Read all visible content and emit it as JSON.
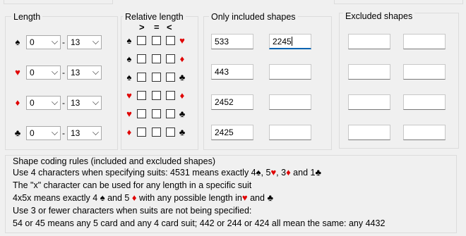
{
  "length": {
    "title": "Length",
    "rows": [
      {
        "suit": "♠",
        "color": "black",
        "min": "0",
        "max": "13"
      },
      {
        "suit": "♥",
        "color": "red",
        "min": "0",
        "max": "13"
      },
      {
        "suit": "♦",
        "color": "red",
        "min": "0",
        "max": "13"
      },
      {
        "suit": "♣",
        "color": "black",
        "min": "0",
        "max": "13"
      }
    ],
    "separator": "-"
  },
  "relative": {
    "title": "Relative length",
    "ops": [
      ">",
      "=",
      "<"
    ],
    "rows": [
      {
        "left": "♠",
        "left_color": "black",
        "right": "♥",
        "right_color": "red"
      },
      {
        "left": "♠",
        "left_color": "black",
        "right": "♦",
        "right_color": "red"
      },
      {
        "left": "♠",
        "left_color": "black",
        "right": "♣",
        "right_color": "black"
      },
      {
        "left": "♥",
        "left_color": "red",
        "right": "♦",
        "right_color": "red"
      },
      {
        "left": "♥",
        "left_color": "red",
        "right": "♣",
        "right_color": "black"
      },
      {
        "left": "♦",
        "left_color": "red",
        "right": "♣",
        "right_color": "black"
      }
    ]
  },
  "included": {
    "title": "Only included shapes",
    "rows": [
      [
        "533",
        "2245"
      ],
      [
        "443",
        ""
      ],
      [
        "2452",
        ""
      ],
      [
        "2425",
        ""
      ]
    ]
  },
  "excluded": {
    "title": "Excluded shapes",
    "rows": [
      [
        "",
        ""
      ],
      [
        "",
        ""
      ],
      [
        "",
        ""
      ],
      [
        "",
        ""
      ]
    ]
  },
  "rules": {
    "title": "Shape coding rules (included and excluded shapes)",
    "line1_a": "Use 4 characters when specifying suits: 4531 means exactly 4",
    "line1_b": ", 5",
    "line1_c": ", 3",
    "line1_d": " and 1",
    "line2": "The \"x\" character can be used for any length in a specific suit",
    "line3_a": "4x5x means exactly 4",
    "line3_b": " and 5",
    "line3_c": " with any possible length in",
    "line3_d": " and",
    "line4": "Use 3 or fewer characters when suits are not being specified:",
    "line5": "54 or 45 means any 5 card and any 4 card suit; 442 or 244 or 424 all mean the same: any 4432"
  },
  "glyphs": {
    "spade": "♠",
    "heart": "♥",
    "diamond": "♦",
    "club": "♣"
  },
  "colors": {
    "red_suit": "#e00000",
    "focus": "#0063b1"
  }
}
